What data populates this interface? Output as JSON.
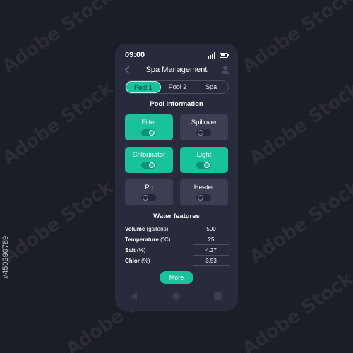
{
  "status_bar": {
    "time": "09:00"
  },
  "header": {
    "title": "Spa Management"
  },
  "tabs": [
    {
      "label": "Pool 1",
      "active": true
    },
    {
      "label": "Pool 2",
      "active": false
    },
    {
      "label": "Spa",
      "active": false
    }
  ],
  "pool_info": {
    "title": "Pool Information",
    "tiles": [
      {
        "label": "Filter",
        "on": true
      },
      {
        "label": "Spillover",
        "on": false
      },
      {
        "label": "Chlorinator",
        "on": true
      },
      {
        "label": "Light",
        "on": true
      },
      {
        "label": "Ph",
        "on": false
      },
      {
        "label": "Heater",
        "on": false
      }
    ]
  },
  "water_features": {
    "title": "Water features",
    "rows": [
      {
        "name": "Volume",
        "unit": "(gallons)",
        "value": "500"
      },
      {
        "name": "Temperature",
        "unit": "(°C)",
        "value": "25"
      },
      {
        "name": "Salt",
        "unit": "(%)",
        "value": "4.27"
      },
      {
        "name": "Chlor",
        "unit": "(%)",
        "value": "3.53"
      }
    ]
  },
  "more_button": {
    "label": "More"
  },
  "watermark": {
    "text": "Adobe Stock",
    "id": "#450290789"
  },
  "colors": {
    "accent": "#18c29c",
    "phone_bg": "#282b3c",
    "page_bg": "#1b1d27",
    "tile_off": "#3c3f53"
  },
  "icons": [
    "signal-icon",
    "battery-icon",
    "back-arrow-icon",
    "profile-icon",
    "nav-back-icon",
    "nav-home-icon",
    "nav-recent-icon"
  ]
}
